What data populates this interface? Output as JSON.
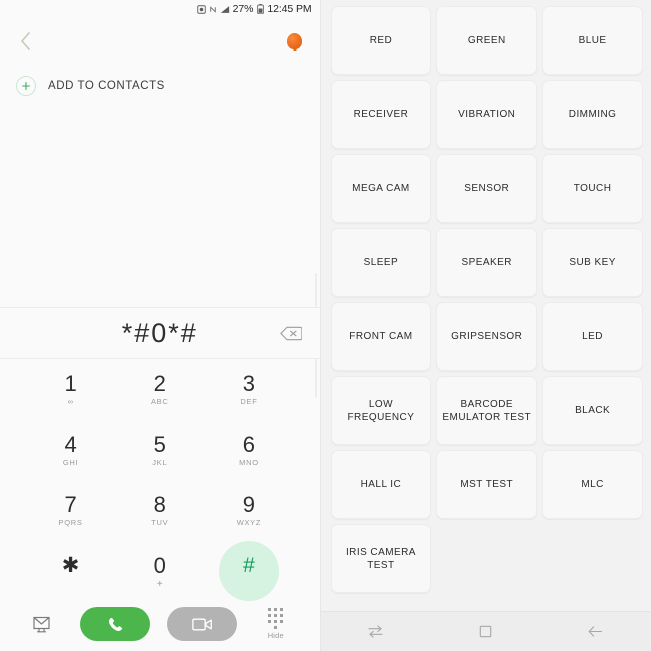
{
  "left_panel": {
    "status_bar": {
      "icons": [
        "alarm-icon",
        "nfc-icon",
        "signal-icon",
        "battery-icon"
      ],
      "battery_percent": "27%",
      "time": "12:45 PM"
    },
    "app_bar": {
      "back_icon": "back-chevron-icon",
      "notification_badge_icon": "balloon-badge-icon"
    },
    "add_to_contacts": {
      "icon": "plus-circle-icon",
      "label": "ADD TO CONTACTS"
    },
    "number_display": {
      "dialed_number": "*#0*#",
      "backspace_icon": "backspace-icon"
    },
    "keypad": [
      {
        "digit": "1",
        "letters": "∞",
        "pressed": false,
        "name": "key-1"
      },
      {
        "digit": "2",
        "letters": "ABC",
        "pressed": false,
        "name": "key-2"
      },
      {
        "digit": "3",
        "letters": "DEF",
        "pressed": false,
        "name": "key-3"
      },
      {
        "digit": "4",
        "letters": "GHI",
        "pressed": false,
        "name": "key-4"
      },
      {
        "digit": "5",
        "letters": "JKL",
        "pressed": false,
        "name": "key-5"
      },
      {
        "digit": "6",
        "letters": "MNO",
        "pressed": false,
        "name": "key-6"
      },
      {
        "digit": "7",
        "letters": "PQRS",
        "pressed": false,
        "name": "key-7"
      },
      {
        "digit": "8",
        "letters": "TUV",
        "pressed": false,
        "name": "key-8"
      },
      {
        "digit": "9",
        "letters": "WXYZ",
        "pressed": false,
        "name": "key-9"
      },
      {
        "digit": "✱",
        "letters": "",
        "pressed": false,
        "name": "key-star"
      },
      {
        "digit": "0",
        "letters": "+",
        "pressed": false,
        "name": "key-0"
      },
      {
        "digit": "#",
        "letters": "",
        "pressed": true,
        "name": "key-hash"
      }
    ],
    "action_bar": {
      "message_icon": "message-icon",
      "call_icon": "phone-handset-icon",
      "video_call_icon": "video-camera-icon",
      "hide_keypad_icon": "keypad-dots-icon",
      "hide_label": "Hide"
    },
    "colors": {
      "accent_green": "#4cb64c",
      "key_press_green": "#12a05c",
      "ripple_green": "#d6f2e0",
      "video_gray": "#b3b3b3",
      "badge_orange": "#ed6c1d",
      "panel_bg": "#fafafa"
    }
  },
  "right_panel": {
    "test_buttons": [
      "RED",
      "GREEN",
      "BLUE",
      "RECEIVER",
      "VIBRATION",
      "DIMMING",
      "MEGA CAM",
      "SENSOR",
      "TOUCH",
      "SLEEP",
      "SPEAKER",
      "SUB KEY",
      "FRONT CAM",
      "GRIPSENSOR",
      "LED",
      "LOW FREQUENCY",
      "BARCODE EMULATOR TEST",
      "BLACK",
      "HALL IC",
      "MST TEST",
      "MLC",
      "IRIS CAMERA TEST"
    ],
    "nav_bar": {
      "recents_icon": "recents-icon",
      "home_icon": "home-square-icon",
      "back_icon": "back-arrow-icon"
    },
    "colors": {
      "panel_bg": "#f2f2f2",
      "card_bg": "#f8f8f8",
      "card_border": "#ececec",
      "nav_bg": "#ededed"
    }
  }
}
